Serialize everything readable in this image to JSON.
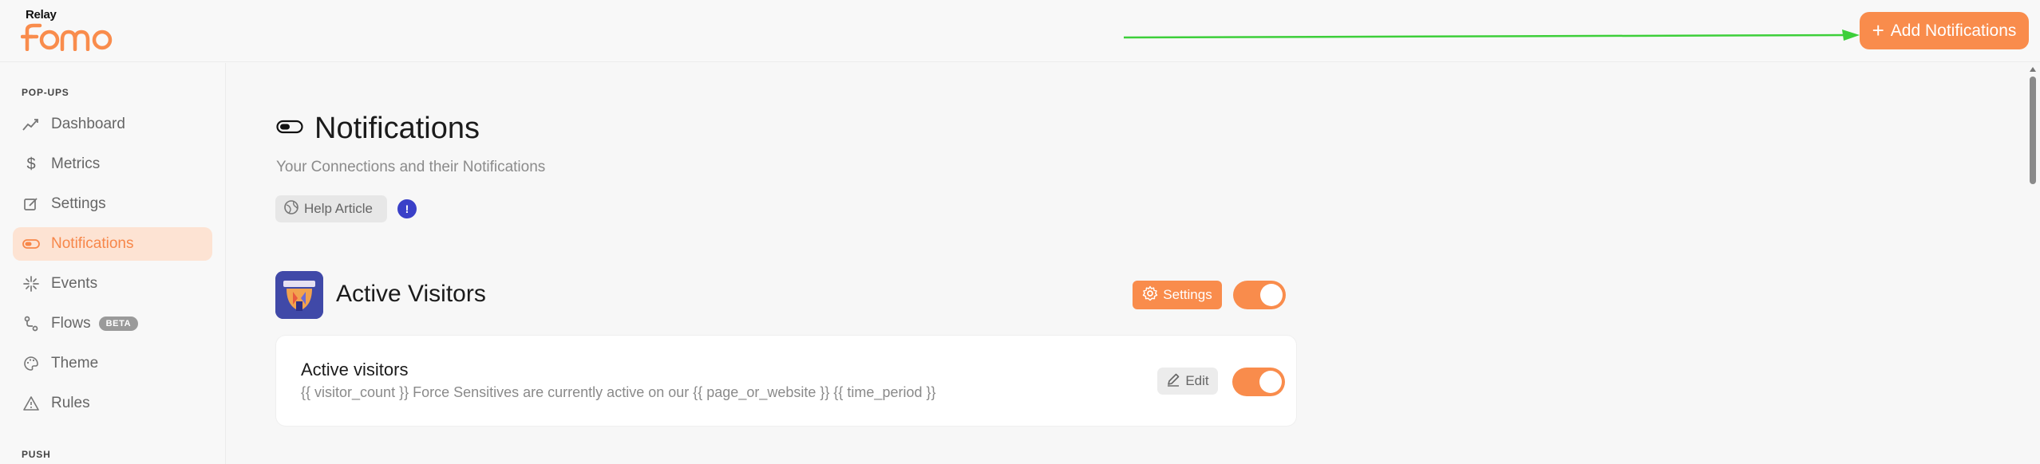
{
  "brand": {
    "relay": "Relay",
    "name": "FOMO",
    "accent": "#f98c4c"
  },
  "header": {
    "add_button_label": "Add Notifications",
    "add_button_icon": "plus-icon"
  },
  "sidebar": {
    "sections": [
      {
        "label": "POP-UPS"
      },
      {
        "label": "PUSH"
      }
    ],
    "items": [
      {
        "label": "Dashboard",
        "icon": "trend-icon"
      },
      {
        "label": "Metrics",
        "icon": "dollar-icon"
      },
      {
        "label": "Settings",
        "icon": "edit-icon"
      },
      {
        "label": "Notifications",
        "icon": "toggle-icon",
        "active": true
      },
      {
        "label": "Events",
        "icon": "sparkle-icon"
      },
      {
        "label": "Flows",
        "icon": "flow-icon",
        "badge": "BETA"
      },
      {
        "label": "Theme",
        "icon": "palette-icon"
      },
      {
        "label": "Rules",
        "icon": "warning-icon"
      }
    ]
  },
  "main": {
    "title": "Notifications",
    "subtitle": "Your Connections and their Notifications",
    "help_label": "Help Article",
    "info_badge": "!",
    "connection": {
      "title": "Active Visitors",
      "settings_label": "Settings",
      "enabled": true
    },
    "notification": {
      "title": "Active visitors",
      "description": "{{ visitor_count }} Force Sensitives are currently active on our {{ page_or_website }} {{ time_period }}",
      "edit_label": "Edit",
      "enabled": true
    }
  }
}
